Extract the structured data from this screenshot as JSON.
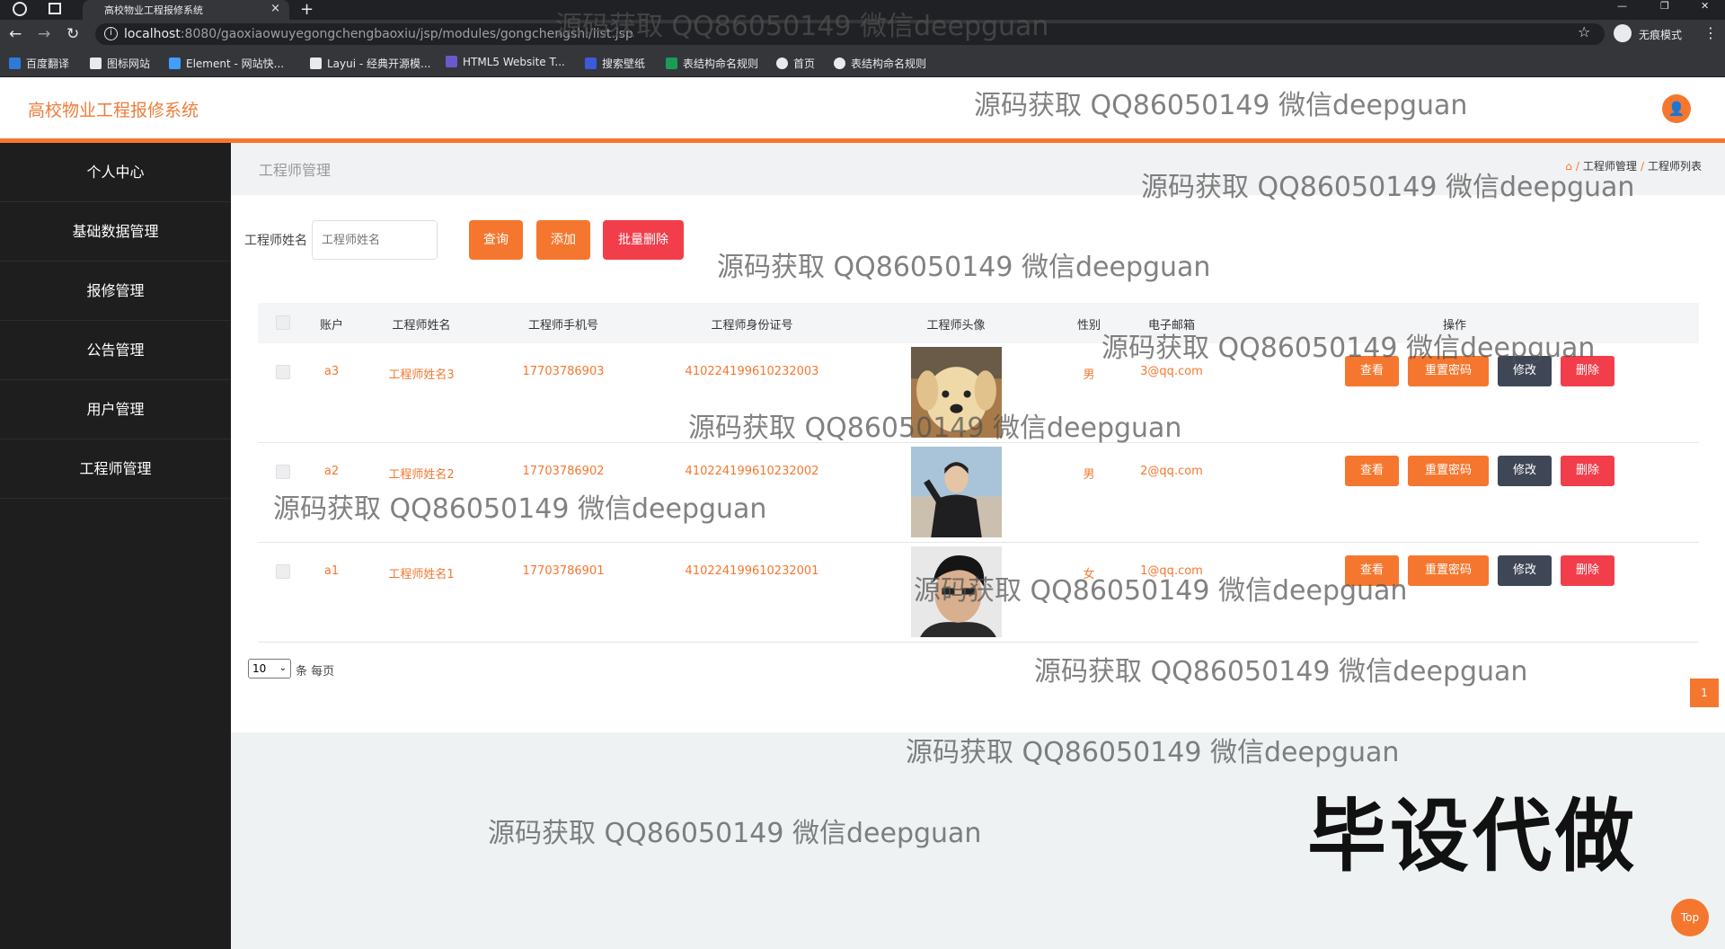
{
  "browser": {
    "tab_title": "高校物业工程报修系统",
    "tab_close": "×",
    "new_tab": "+",
    "minimize": "—",
    "restore": "❐",
    "close": "✕",
    "back": "←",
    "forward": "→",
    "reload": "↻",
    "url_info": "i",
    "url_host": "localhost",
    "url_path": ":8080/gaoxiaowuyegongchengbaoxiu/jsp/modules/gongchengshi/list.jsp",
    "star": "☆",
    "incognito_label": "无痕模式",
    "more": "⋮",
    "bookmarks": [
      {
        "label": "百度翻译",
        "icon": "translate-icon",
        "color": "#2f79d8"
      },
      {
        "label": "图标网站",
        "icon": "flag-icon",
        "color": "#e8eaed"
      },
      {
        "label": "Element - 网站快...",
        "icon": "element-icon",
        "color": "#409eff"
      },
      {
        "label": "Layui - 经典开源模...",
        "icon": "layui-icon",
        "color": "#e8eaed"
      },
      {
        "label": "HTML5 Website T...",
        "icon": "html5-icon",
        "color": "#6a5acd"
      },
      {
        "label": "搜索壁纸",
        "icon": "wallpaper-icon",
        "color": "#3b5bdb"
      },
      {
        "label": "表结构命名规则",
        "icon": "table-icon",
        "color": "#1a9c55"
      },
      {
        "label": "首页",
        "icon": "globe-icon",
        "color": "#e8eaed"
      },
      {
        "label": "表结构命名规则",
        "icon": "globe-icon",
        "color": "#e8eaed"
      }
    ]
  },
  "app": {
    "title": "高校物业工程报修系统",
    "user_icon": "👤",
    "accent": "#f5772f"
  },
  "sidebar": {
    "items": [
      {
        "label": "个人中心"
      },
      {
        "label": "基础数据管理"
      },
      {
        "label": "报修管理"
      },
      {
        "label": "公告管理"
      },
      {
        "label": "用户管理"
      },
      {
        "label": "工程师管理"
      }
    ]
  },
  "page": {
    "title": "工程师管理",
    "breadcrumb": {
      "home_icon": "⌂",
      "sep": "/",
      "section": "工程师管理",
      "current": "工程师列表"
    }
  },
  "search": {
    "label": "工程师姓名",
    "placeholder": "工程师姓名",
    "query_button": "查询",
    "add_button": "添加",
    "batch_delete_button": "批量删除"
  },
  "table": {
    "headers": {
      "account": "账户",
      "name": "工程师姓名",
      "phone": "工程师手机号",
      "id_card": "工程师身份证号",
      "photo": "工程师头像",
      "gender": "性别",
      "email": "电子邮箱",
      "actions": "操作"
    },
    "action_labels": {
      "view": "查看",
      "reset": "重置密码",
      "edit": "修改",
      "delete": "删除"
    },
    "rows": [
      {
        "account": "a3",
        "name": "工程师姓名3",
        "phone": "17703786903",
        "id_card": "410224199610232003",
        "gender": "男",
        "email": "3@qq.com",
        "photo": "dog-photo"
      },
      {
        "account": "a2",
        "name": "工程师姓名2",
        "phone": "17703786902",
        "id_card": "410224199610232002",
        "gender": "男",
        "email": "2@qq.com",
        "photo": "man-beach-photo"
      },
      {
        "account": "a1",
        "name": "工程师姓名1",
        "phone": "17703786901",
        "id_card": "410224199610232001",
        "gender": "女",
        "email": "1@qq.com",
        "photo": "man-portrait-photo"
      }
    ]
  },
  "pagination": {
    "page_size": "10",
    "page_size_arrow": "⌄",
    "per_page_label": "条 每页",
    "current_page": "1"
  },
  "top_button": "Top",
  "banner": "毕设代做",
  "watermark": "源码获取 QQ86050149 微信deepguan"
}
